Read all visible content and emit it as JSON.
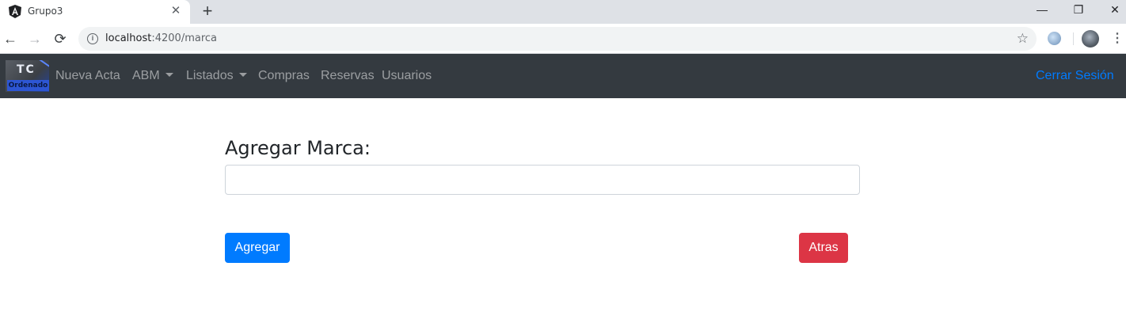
{
  "browser": {
    "tab_title": "Grupo3",
    "tab_close_glyph": "✕",
    "new_tab_glyph": "+",
    "window_controls": {
      "minimize": "—",
      "restore": "❐",
      "close": "✕"
    },
    "url_host": "localhost",
    "url_path": ":4200/marca",
    "favicon_icon": "angular-icon",
    "nav_icons": {
      "back": "←",
      "forward": "→",
      "reload": "⟳"
    },
    "info_glyph": "i",
    "star_glyph": "☆",
    "menu_glyph": "⋮"
  },
  "navbar": {
    "brand": {
      "top_text": "TC",
      "bottom_text": "Ordenado"
    },
    "links": [
      {
        "label": "Nueva Acta",
        "dropdown": false
      },
      {
        "label": "ABM",
        "dropdown": true
      },
      {
        "label": "Listados",
        "dropdown": true
      },
      {
        "label": "Compras",
        "dropdown": false
      },
      {
        "label": "Reservas",
        "dropdown": false
      },
      {
        "label": "Usuarios",
        "dropdown": false
      }
    ],
    "logout_label": "Cerrar Sesión",
    "colors": {
      "background": "#343a40",
      "link": "rgba(255,255,255,0.5)",
      "logout": "#007bff"
    }
  },
  "form": {
    "title": "Agregar Marca:",
    "input_value": "",
    "input_placeholder": "",
    "submit_label": "Agregar",
    "back_label": "Atras",
    "colors": {
      "submit": "#007bff",
      "back": "#dc3545"
    }
  }
}
